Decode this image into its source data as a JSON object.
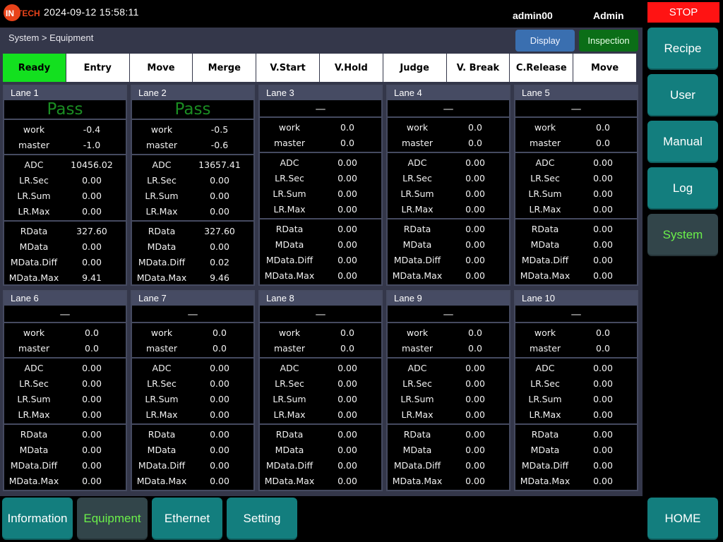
{
  "header": {
    "logo_text": "INTECH",
    "datetime": "2024-09-12 15:58:11",
    "user": "admin00",
    "role": "Admin"
  },
  "breadcrumb": "System > Equipment",
  "buttons": {
    "display": "Display",
    "inspection": "Inspection"
  },
  "steps": [
    "Ready",
    "Entry",
    "Move",
    "Merge",
    "V.Start",
    "V.Hold",
    "Judge",
    "V. Break",
    "C.Release",
    "Move"
  ],
  "active_step": 0,
  "lanes": [
    {
      "name": "Lane 1",
      "result": "Pass",
      "work": "-0.4",
      "master": "-1.0",
      "adc": "10456.02",
      "lr_sec": "0.00",
      "lr_sum": "0.00",
      "lr_max": "0.00",
      "rdata": "327.60",
      "mdata": "0.00",
      "mdata_diff": "0.00",
      "mdata_max": "9.41"
    },
    {
      "name": "Lane 2",
      "result": "Pass",
      "work": "-0.5",
      "master": "-0.6",
      "adc": "13657.41",
      "lr_sec": "0.00",
      "lr_sum": "0.00",
      "lr_max": "0.00",
      "rdata": "327.60",
      "mdata": "0.00",
      "mdata_diff": "0.02",
      "mdata_max": "9.46"
    },
    {
      "name": "Lane 3",
      "result": "—",
      "work": "0.0",
      "master": "0.0",
      "adc": "0.00",
      "lr_sec": "0.00",
      "lr_sum": "0.00",
      "lr_max": "0.00",
      "rdata": "0.00",
      "mdata": "0.00",
      "mdata_diff": "0.00",
      "mdata_max": "0.00"
    },
    {
      "name": "Lane 4",
      "result": "—",
      "work": "0.0",
      "master": "0.0",
      "adc": "0.00",
      "lr_sec": "0.00",
      "lr_sum": "0.00",
      "lr_max": "0.00",
      "rdata": "0.00",
      "mdata": "0.00",
      "mdata_diff": "0.00",
      "mdata_max": "0.00"
    },
    {
      "name": "Lane 5",
      "result": "—",
      "work": "0.0",
      "master": "0.0",
      "adc": "0.00",
      "lr_sec": "0.00",
      "lr_sum": "0.00",
      "lr_max": "0.00",
      "rdata": "0.00",
      "mdata": "0.00",
      "mdata_diff": "0.00",
      "mdata_max": "0.00"
    },
    {
      "name": "Lane 6",
      "result": "—",
      "work": "0.0",
      "master": "0.0",
      "adc": "0.00",
      "lr_sec": "0.00",
      "lr_sum": "0.00",
      "lr_max": "0.00",
      "rdata": "0.00",
      "mdata": "0.00",
      "mdata_diff": "0.00",
      "mdata_max": "0.00"
    },
    {
      "name": "Lane 7",
      "result": "—",
      "work": "0.0",
      "master": "0.0",
      "adc": "0.00",
      "lr_sec": "0.00",
      "lr_sum": "0.00",
      "lr_max": "0.00",
      "rdata": "0.00",
      "mdata": "0.00",
      "mdata_diff": "0.00",
      "mdata_max": "0.00"
    },
    {
      "name": "Lane 8",
      "result": "—",
      "work": "0.0",
      "master": "0.0",
      "adc": "0.00",
      "lr_sec": "0.00",
      "lr_sum": "0.00",
      "lr_max": "0.00",
      "rdata": "0.00",
      "mdata": "0.00",
      "mdata_diff": "0.00",
      "mdata_max": "0.00"
    },
    {
      "name": "Lane 9",
      "result": "—",
      "work": "0.0",
      "master": "0.0",
      "adc": "0.00",
      "lr_sec": "0.00",
      "lr_sum": "0.00",
      "lr_max": "0.00",
      "rdata": "0.00",
      "mdata": "0.00",
      "mdata_diff": "0.00",
      "mdata_max": "0.00"
    },
    {
      "name": "Lane 10",
      "result": "—",
      "work": "0.0",
      "master": "0.0",
      "adc": "0.00",
      "lr_sec": "0.00",
      "lr_sum": "0.00",
      "lr_max": "0.00",
      "rdata": "0.00",
      "mdata": "0.00",
      "mdata_diff": "0.00",
      "mdata_max": "0.00"
    }
  ],
  "lane_labels": {
    "work": "work",
    "master": "master",
    "adc": "ADC",
    "lr_sec": "LR.Sec",
    "lr_sum": "LR.Sum",
    "lr_max": "LR.Max",
    "rdata": "RData",
    "mdata": "MData",
    "mdata_diff": "MData.Diff",
    "mdata_max": "MData.Max"
  },
  "sidebar": {
    "stop": "STOP",
    "items": [
      "Recipe",
      "User",
      "Manual",
      "Log",
      "System"
    ],
    "active": "System",
    "home": "HOME"
  },
  "tabs": {
    "items": [
      "Information",
      "Equipment",
      "Ethernet",
      "Setting"
    ],
    "active": "Equipment"
  },
  "colors": {
    "pass": "#1a8c22",
    "active_step": "#13e01f",
    "stop": "#ff1313",
    "nav_button": "#137e7e",
    "nav_active_text": "#6bf04a"
  }
}
